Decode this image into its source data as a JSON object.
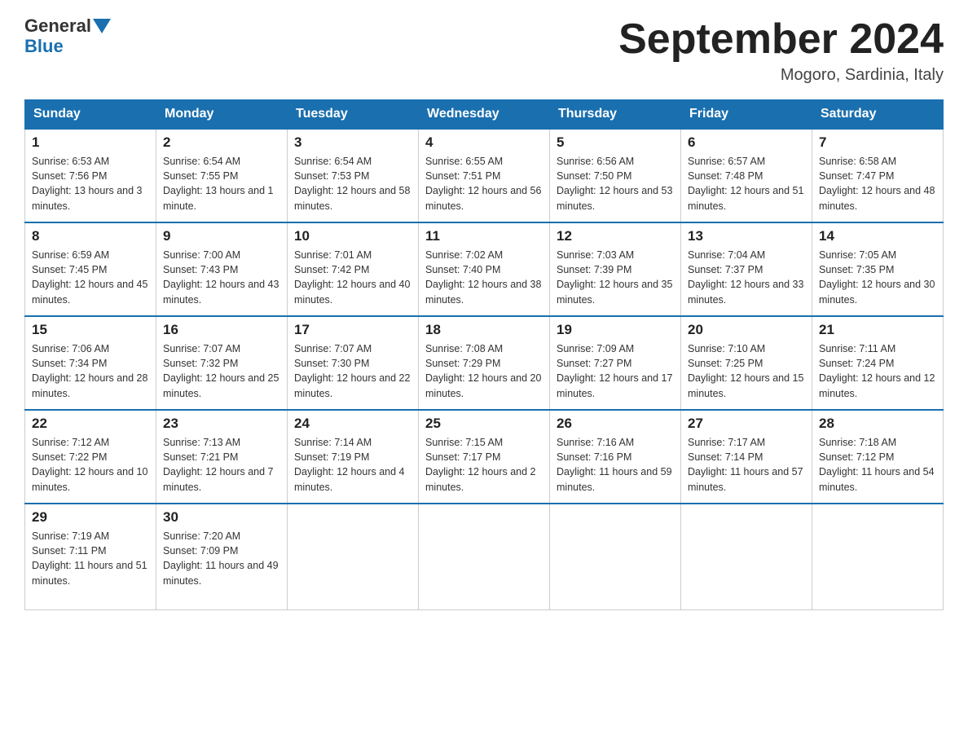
{
  "header": {
    "logo_general": "General",
    "logo_blue": "Blue",
    "month_title": "September 2024",
    "location": "Mogoro, Sardinia, Italy"
  },
  "days_of_week": [
    "Sunday",
    "Monday",
    "Tuesday",
    "Wednesday",
    "Thursday",
    "Friday",
    "Saturday"
  ],
  "weeks": [
    [
      {
        "day": "1",
        "sunrise": "6:53 AM",
        "sunset": "7:56 PM",
        "daylight": "13 hours and 3 minutes."
      },
      {
        "day": "2",
        "sunrise": "6:54 AM",
        "sunset": "7:55 PM",
        "daylight": "13 hours and 1 minute."
      },
      {
        "day": "3",
        "sunrise": "6:54 AM",
        "sunset": "7:53 PM",
        "daylight": "12 hours and 58 minutes."
      },
      {
        "day": "4",
        "sunrise": "6:55 AM",
        "sunset": "7:51 PM",
        "daylight": "12 hours and 56 minutes."
      },
      {
        "day": "5",
        "sunrise": "6:56 AM",
        "sunset": "7:50 PM",
        "daylight": "12 hours and 53 minutes."
      },
      {
        "day": "6",
        "sunrise": "6:57 AM",
        "sunset": "7:48 PM",
        "daylight": "12 hours and 51 minutes."
      },
      {
        "day": "7",
        "sunrise": "6:58 AM",
        "sunset": "7:47 PM",
        "daylight": "12 hours and 48 minutes."
      }
    ],
    [
      {
        "day": "8",
        "sunrise": "6:59 AM",
        "sunset": "7:45 PM",
        "daylight": "12 hours and 45 minutes."
      },
      {
        "day": "9",
        "sunrise": "7:00 AM",
        "sunset": "7:43 PM",
        "daylight": "12 hours and 43 minutes."
      },
      {
        "day": "10",
        "sunrise": "7:01 AM",
        "sunset": "7:42 PM",
        "daylight": "12 hours and 40 minutes."
      },
      {
        "day": "11",
        "sunrise": "7:02 AM",
        "sunset": "7:40 PM",
        "daylight": "12 hours and 38 minutes."
      },
      {
        "day": "12",
        "sunrise": "7:03 AM",
        "sunset": "7:39 PM",
        "daylight": "12 hours and 35 minutes."
      },
      {
        "day": "13",
        "sunrise": "7:04 AM",
        "sunset": "7:37 PM",
        "daylight": "12 hours and 33 minutes."
      },
      {
        "day": "14",
        "sunrise": "7:05 AM",
        "sunset": "7:35 PM",
        "daylight": "12 hours and 30 minutes."
      }
    ],
    [
      {
        "day": "15",
        "sunrise": "7:06 AM",
        "sunset": "7:34 PM",
        "daylight": "12 hours and 28 minutes."
      },
      {
        "day": "16",
        "sunrise": "7:07 AM",
        "sunset": "7:32 PM",
        "daylight": "12 hours and 25 minutes."
      },
      {
        "day": "17",
        "sunrise": "7:07 AM",
        "sunset": "7:30 PM",
        "daylight": "12 hours and 22 minutes."
      },
      {
        "day": "18",
        "sunrise": "7:08 AM",
        "sunset": "7:29 PM",
        "daylight": "12 hours and 20 minutes."
      },
      {
        "day": "19",
        "sunrise": "7:09 AM",
        "sunset": "7:27 PM",
        "daylight": "12 hours and 17 minutes."
      },
      {
        "day": "20",
        "sunrise": "7:10 AM",
        "sunset": "7:25 PM",
        "daylight": "12 hours and 15 minutes."
      },
      {
        "day": "21",
        "sunrise": "7:11 AM",
        "sunset": "7:24 PM",
        "daylight": "12 hours and 12 minutes."
      }
    ],
    [
      {
        "day": "22",
        "sunrise": "7:12 AM",
        "sunset": "7:22 PM",
        "daylight": "12 hours and 10 minutes."
      },
      {
        "day": "23",
        "sunrise": "7:13 AM",
        "sunset": "7:21 PM",
        "daylight": "12 hours and 7 minutes."
      },
      {
        "day": "24",
        "sunrise": "7:14 AM",
        "sunset": "7:19 PM",
        "daylight": "12 hours and 4 minutes."
      },
      {
        "day": "25",
        "sunrise": "7:15 AM",
        "sunset": "7:17 PM",
        "daylight": "12 hours and 2 minutes."
      },
      {
        "day": "26",
        "sunrise": "7:16 AM",
        "sunset": "7:16 PM",
        "daylight": "11 hours and 59 minutes."
      },
      {
        "day": "27",
        "sunrise": "7:17 AM",
        "sunset": "7:14 PM",
        "daylight": "11 hours and 57 minutes."
      },
      {
        "day": "28",
        "sunrise": "7:18 AM",
        "sunset": "7:12 PM",
        "daylight": "11 hours and 54 minutes."
      }
    ],
    [
      {
        "day": "29",
        "sunrise": "7:19 AM",
        "sunset": "7:11 PM",
        "daylight": "11 hours and 51 minutes."
      },
      {
        "day": "30",
        "sunrise": "7:20 AM",
        "sunset": "7:09 PM",
        "daylight": "11 hours and 49 minutes."
      },
      null,
      null,
      null,
      null,
      null
    ]
  ]
}
